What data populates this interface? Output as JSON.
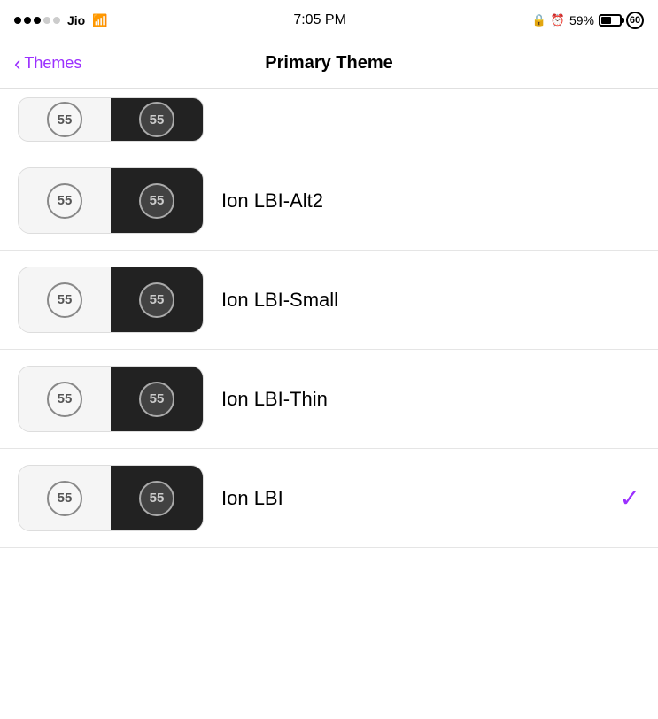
{
  "status_bar": {
    "carrier": "Jio",
    "time": "7:05 PM",
    "battery_percent": "59%",
    "battery_badge": "60"
  },
  "nav": {
    "back_label": "Themes",
    "title": "Primary Theme"
  },
  "themes": [
    {
      "id": "partial",
      "name": "",
      "badge_value": "55",
      "selected": false,
      "partial": true
    },
    {
      "id": "ion-lbi-alt2",
      "name": "Ion LBI-Alt2",
      "badge_value": "55",
      "selected": false,
      "partial": false
    },
    {
      "id": "ion-lbi-small",
      "name": "Ion LBI-Small",
      "badge_value": "55",
      "selected": false,
      "partial": false
    },
    {
      "id": "ion-lbi-thin",
      "name": "Ion LBI-Thin",
      "badge_value": "55",
      "selected": false,
      "partial": false
    },
    {
      "id": "ion-lbi",
      "name": "Ion LBI",
      "badge_value": "55",
      "selected": true,
      "partial": false
    }
  ],
  "checkmark": "✓",
  "back_chevron": "‹"
}
